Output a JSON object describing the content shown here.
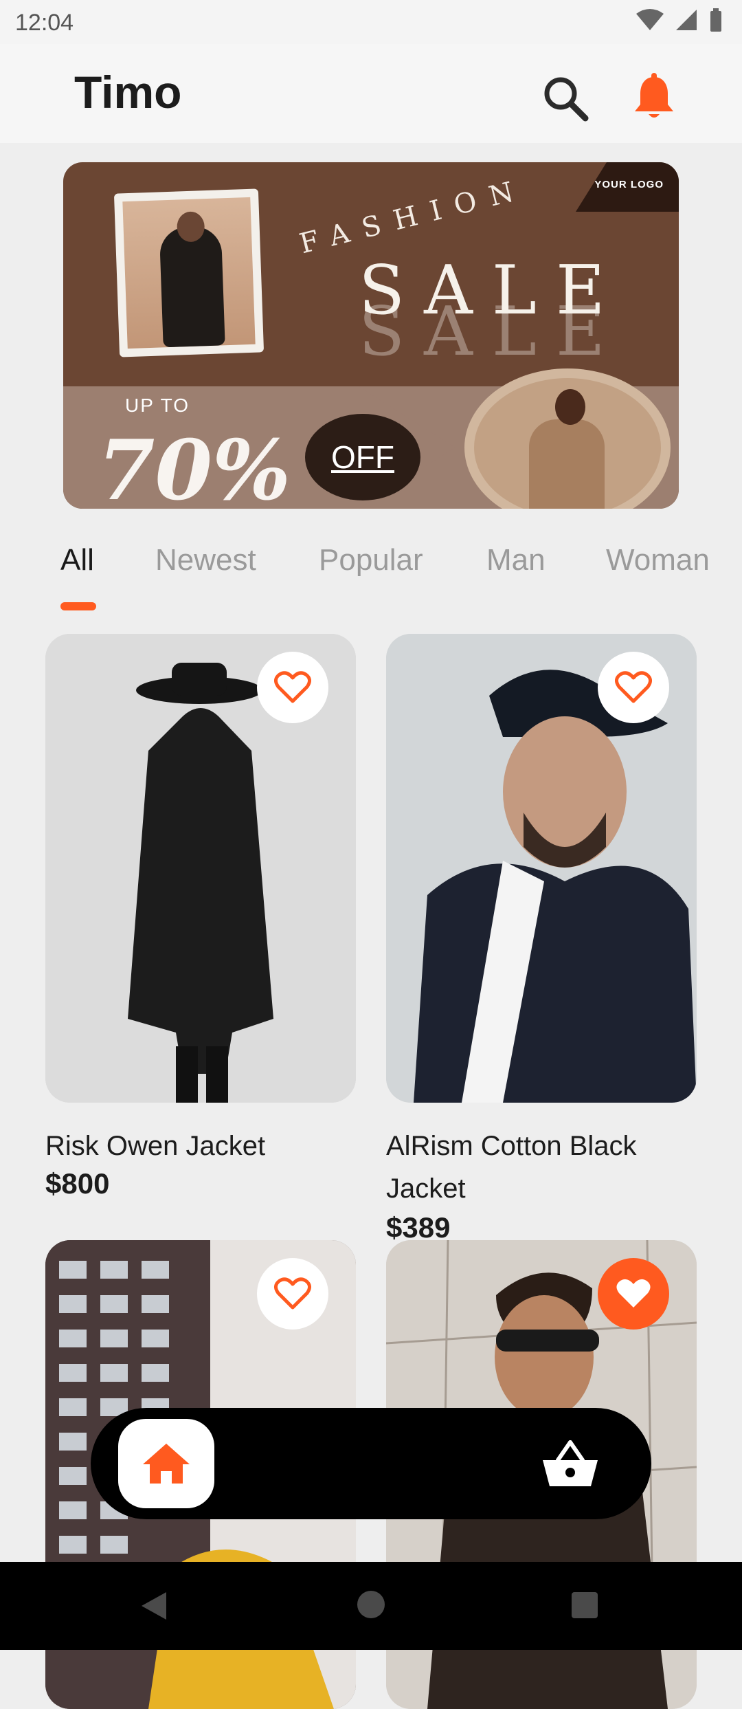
{
  "status": {
    "time": "12:04"
  },
  "header": {
    "title": "Timo"
  },
  "banner": {
    "fashion": "FASHION",
    "sale": "SALE",
    "logo": "YOUR LOGO",
    "up_to": "UP TO",
    "percent": "70%",
    "off": "OFF"
  },
  "tabs": [
    {
      "label": "All",
      "active": true
    },
    {
      "label": "Newest",
      "active": false
    },
    {
      "label": "Popular",
      "active": false
    },
    {
      "label": "Man",
      "active": false
    },
    {
      "label": "Woman",
      "active": false
    }
  ],
  "products": [
    {
      "name": "Risk Owen Jacket",
      "price": "$800",
      "favorite": false
    },
    {
      "name": "AlRism Cotton Black Jacket",
      "price": "$389",
      "favorite": false
    },
    {
      "name": "",
      "price": "",
      "favorite": false
    },
    {
      "name": "",
      "price": "",
      "favorite": true
    }
  ],
  "colors": {
    "accent": "#ff5a1f",
    "nav_bg": "#000000",
    "banner_bg": "#6b4633"
  },
  "icons": {
    "search": "search-icon",
    "bell": "bell-icon",
    "heart": "heart-icon",
    "home": "home-icon",
    "cart": "basket-icon"
  }
}
